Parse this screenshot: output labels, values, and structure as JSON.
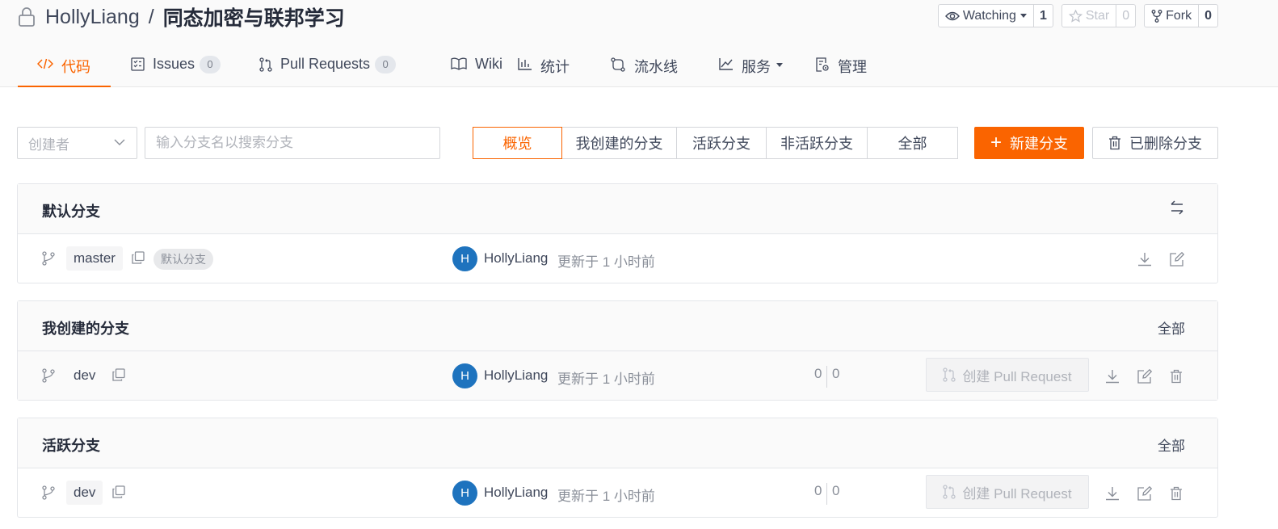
{
  "repo": {
    "owner": "HollyLiang",
    "separator": "/",
    "name": "同态加密与联邦学习",
    "watch": {
      "label": "Watching",
      "count": "1"
    },
    "star": {
      "label": "Star",
      "count": "0"
    },
    "fork": {
      "label": "Fork",
      "count": "0"
    }
  },
  "tabs": [
    {
      "label": "代码",
      "active": true
    },
    {
      "label": "Issues",
      "badge": "0"
    },
    {
      "label": "Pull Requests",
      "badge": "0"
    },
    {
      "label": "Wiki"
    },
    {
      "label": "统计"
    },
    {
      "label": "流水线"
    },
    {
      "label": "服务"
    },
    {
      "label": "管理"
    }
  ],
  "filters": {
    "creator_placeholder": "创建者",
    "search_placeholder": "输入分支名以搜索分支",
    "segments": [
      "概览",
      "我创建的分支",
      "活跃分支",
      "非活跃分支",
      "全部"
    ],
    "new_branch": "新建分支",
    "deleted_branch": "已删除分支"
  },
  "sections": {
    "default": {
      "title": "默认分支",
      "row": {
        "branch": "master",
        "tag": "默认分支",
        "avatar": "H",
        "author": "HollyLiang",
        "updated": "更新于 1 小时前"
      }
    },
    "mine": {
      "title": "我创建的分支",
      "link": "全部",
      "row": {
        "branch": "dev",
        "avatar": "H",
        "author": "HollyLiang",
        "updated": "更新于 1 小时前",
        "ahead": "0",
        "behind": "0",
        "pr_label": "创建 Pull Request"
      }
    },
    "active": {
      "title": "活跃分支",
      "link": "全部",
      "row": {
        "branch": "dev",
        "avatar": "H",
        "author": "HollyLiang",
        "updated": "更新于 1 小时前",
        "ahead": "0",
        "behind": "0",
        "pr_label": "创建 Pull Request"
      }
    }
  },
  "colors": {
    "accent": "#fa6400",
    "avatar": "#1e73be"
  }
}
